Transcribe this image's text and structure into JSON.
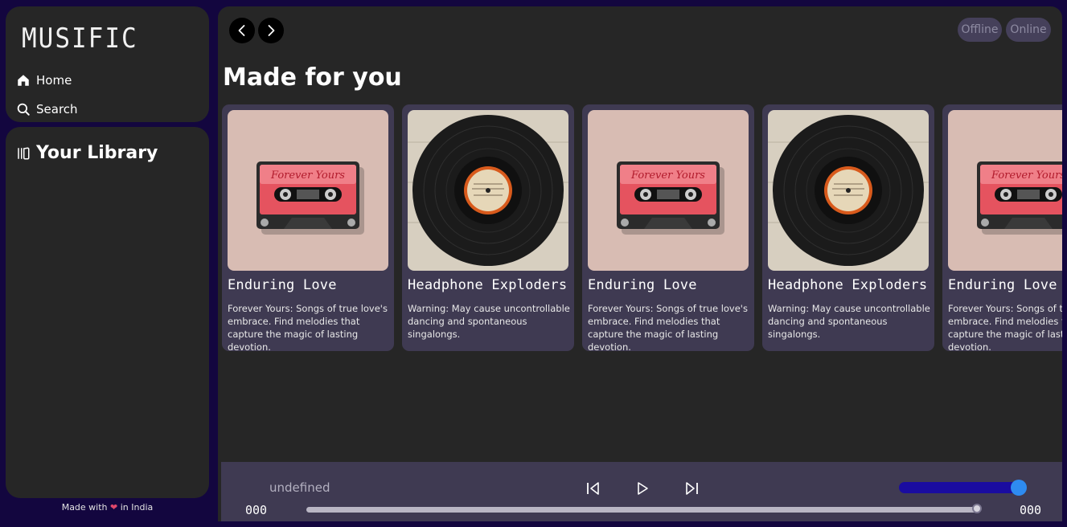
{
  "app": {
    "logo": "MUSIFIC"
  },
  "sidebar": {
    "nav": [
      {
        "label": "Home",
        "icon": "home-icon"
      },
      {
        "label": "Search",
        "icon": "search-icon"
      }
    ],
    "library": {
      "label": "Your Library",
      "icon": "library-icon"
    },
    "footer": {
      "prefix": "Made with",
      "heart": "❤",
      "suffix": "in India"
    }
  },
  "topbar": {
    "back_icon": "chevron-left-icon",
    "forward_icon": "chevron-right-icon",
    "status": [
      "Offline",
      "Online"
    ]
  },
  "main": {
    "section_title": "Made for you",
    "cards": [
      {
        "title": "Enduring Love",
        "desc": "Forever Yours: Songs of true love's embrace. Find melodies that capture the magic of lasting devotion.",
        "art": "cassette",
        "cassette_label": "Forever Yours"
      },
      {
        "title": "Headphone Exploders",
        "desc": "Warning: May cause uncontrollable dancing and spontaneous singalongs.",
        "art": "vinyl"
      },
      {
        "title": "Enduring Love",
        "desc": "Forever Yours: Songs of true love's embrace. Find melodies that capture the magic of lasting devotion.",
        "art": "cassette",
        "cassette_label": "Forever Yours"
      },
      {
        "title": "Headphone Exploders",
        "desc": "Warning: May cause uncontrollable dancing and spontaneous singalongs.",
        "art": "vinyl"
      },
      {
        "title": "Enduring Love",
        "desc": "Forever Yours: Songs of true love's embrace. Find melodies that capture the magic of lasting devotion.",
        "art": "cassette",
        "cassette_label": "Forever Yours"
      }
    ]
  },
  "player": {
    "track": "undefined",
    "time_current": "000",
    "time_total": "000",
    "progress": 0.995,
    "volume": 0.95,
    "icons": {
      "prev": "skip-back-icon",
      "play": "play-icon",
      "next": "skip-forward-icon"
    }
  },
  "colors": {
    "background": "#13063f",
    "panel": "#262626",
    "card": "#3f3a52",
    "accent": "#2e8bf0",
    "volume_track": "#1a0ca0"
  }
}
